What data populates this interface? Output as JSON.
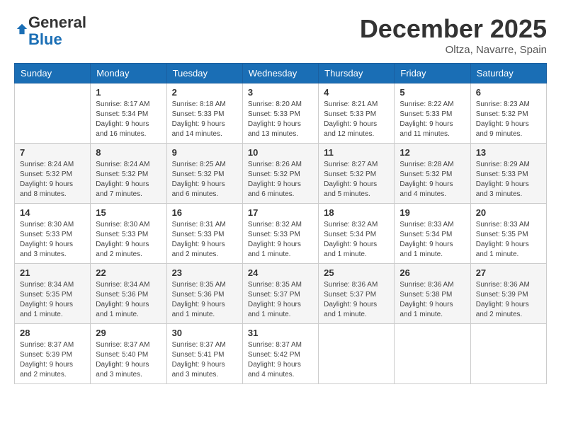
{
  "logo": {
    "general": "General",
    "blue": "Blue"
  },
  "header": {
    "month": "December 2025",
    "location": "Oltza, Navarre, Spain"
  },
  "weekdays": [
    "Sunday",
    "Monday",
    "Tuesday",
    "Wednesday",
    "Thursday",
    "Friday",
    "Saturday"
  ],
  "weeks": [
    [
      {
        "day": "",
        "info": ""
      },
      {
        "day": "1",
        "info": "Sunrise: 8:17 AM\nSunset: 5:34 PM\nDaylight: 9 hours\nand 16 minutes."
      },
      {
        "day": "2",
        "info": "Sunrise: 8:18 AM\nSunset: 5:33 PM\nDaylight: 9 hours\nand 14 minutes."
      },
      {
        "day": "3",
        "info": "Sunrise: 8:20 AM\nSunset: 5:33 PM\nDaylight: 9 hours\nand 13 minutes."
      },
      {
        "day": "4",
        "info": "Sunrise: 8:21 AM\nSunset: 5:33 PM\nDaylight: 9 hours\nand 12 minutes."
      },
      {
        "day": "5",
        "info": "Sunrise: 8:22 AM\nSunset: 5:33 PM\nDaylight: 9 hours\nand 11 minutes."
      },
      {
        "day": "6",
        "info": "Sunrise: 8:23 AM\nSunset: 5:32 PM\nDaylight: 9 hours\nand 9 minutes."
      }
    ],
    [
      {
        "day": "7",
        "info": "Sunrise: 8:24 AM\nSunset: 5:32 PM\nDaylight: 9 hours\nand 8 minutes."
      },
      {
        "day": "8",
        "info": "Sunrise: 8:24 AM\nSunset: 5:32 PM\nDaylight: 9 hours\nand 7 minutes."
      },
      {
        "day": "9",
        "info": "Sunrise: 8:25 AM\nSunset: 5:32 PM\nDaylight: 9 hours\nand 6 minutes."
      },
      {
        "day": "10",
        "info": "Sunrise: 8:26 AM\nSunset: 5:32 PM\nDaylight: 9 hours\nand 6 minutes."
      },
      {
        "day": "11",
        "info": "Sunrise: 8:27 AM\nSunset: 5:32 PM\nDaylight: 9 hours\nand 5 minutes."
      },
      {
        "day": "12",
        "info": "Sunrise: 8:28 AM\nSunset: 5:32 PM\nDaylight: 9 hours\nand 4 minutes."
      },
      {
        "day": "13",
        "info": "Sunrise: 8:29 AM\nSunset: 5:33 PM\nDaylight: 9 hours\nand 3 minutes."
      }
    ],
    [
      {
        "day": "14",
        "info": "Sunrise: 8:30 AM\nSunset: 5:33 PM\nDaylight: 9 hours\nand 3 minutes."
      },
      {
        "day": "15",
        "info": "Sunrise: 8:30 AM\nSunset: 5:33 PM\nDaylight: 9 hours\nand 2 minutes."
      },
      {
        "day": "16",
        "info": "Sunrise: 8:31 AM\nSunset: 5:33 PM\nDaylight: 9 hours\nand 2 minutes."
      },
      {
        "day": "17",
        "info": "Sunrise: 8:32 AM\nSunset: 5:33 PM\nDaylight: 9 hours\nand 1 minute."
      },
      {
        "day": "18",
        "info": "Sunrise: 8:32 AM\nSunset: 5:34 PM\nDaylight: 9 hours\nand 1 minute."
      },
      {
        "day": "19",
        "info": "Sunrise: 8:33 AM\nSunset: 5:34 PM\nDaylight: 9 hours\nand 1 minute."
      },
      {
        "day": "20",
        "info": "Sunrise: 8:33 AM\nSunset: 5:35 PM\nDaylight: 9 hours\nand 1 minute."
      }
    ],
    [
      {
        "day": "21",
        "info": "Sunrise: 8:34 AM\nSunset: 5:35 PM\nDaylight: 9 hours\nand 1 minute."
      },
      {
        "day": "22",
        "info": "Sunrise: 8:34 AM\nSunset: 5:36 PM\nDaylight: 9 hours\nand 1 minute."
      },
      {
        "day": "23",
        "info": "Sunrise: 8:35 AM\nSunset: 5:36 PM\nDaylight: 9 hours\nand 1 minute."
      },
      {
        "day": "24",
        "info": "Sunrise: 8:35 AM\nSunset: 5:37 PM\nDaylight: 9 hours\nand 1 minute."
      },
      {
        "day": "25",
        "info": "Sunrise: 8:36 AM\nSunset: 5:37 PM\nDaylight: 9 hours\nand 1 minute."
      },
      {
        "day": "26",
        "info": "Sunrise: 8:36 AM\nSunset: 5:38 PM\nDaylight: 9 hours\nand 1 minute."
      },
      {
        "day": "27",
        "info": "Sunrise: 8:36 AM\nSunset: 5:39 PM\nDaylight: 9 hours\nand 2 minutes."
      }
    ],
    [
      {
        "day": "28",
        "info": "Sunrise: 8:37 AM\nSunset: 5:39 PM\nDaylight: 9 hours\nand 2 minutes."
      },
      {
        "day": "29",
        "info": "Sunrise: 8:37 AM\nSunset: 5:40 PM\nDaylight: 9 hours\nand 3 minutes."
      },
      {
        "day": "30",
        "info": "Sunrise: 8:37 AM\nSunset: 5:41 PM\nDaylight: 9 hours\nand 3 minutes."
      },
      {
        "day": "31",
        "info": "Sunrise: 8:37 AM\nSunset: 5:42 PM\nDaylight: 9 hours\nand 4 minutes."
      },
      {
        "day": "",
        "info": ""
      },
      {
        "day": "",
        "info": ""
      },
      {
        "day": "",
        "info": ""
      }
    ]
  ]
}
